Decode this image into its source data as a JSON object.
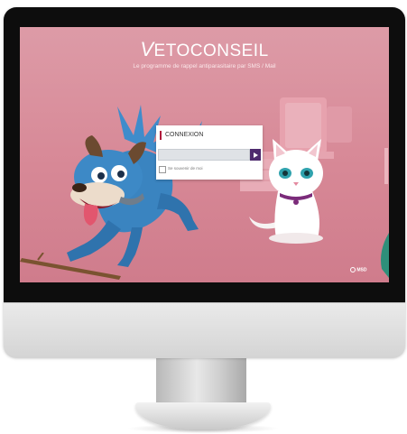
{
  "screen": {
    "logo_initial": "V",
    "logo_rest": "ETOCONSEIL",
    "tagline": "Le programme de rappel antiparasitaire par SMS / Mail",
    "footer_brand": "MSD"
  },
  "login": {
    "title": "CONNEXION",
    "field_value": "",
    "submit_icon": "play-arrow-icon",
    "remember_label": "Se souvenir de moi"
  },
  "illustrations": {
    "left": "cartoon-dog",
    "right": "cartoon-white-cat",
    "foreground": "stick"
  },
  "colors": {
    "background_pink": "#d78896",
    "accent_red": "#b0153b",
    "submit_purple": "#4e2a6e",
    "dog_blue": "#3b83bf",
    "cat_white": "#ffffff"
  }
}
